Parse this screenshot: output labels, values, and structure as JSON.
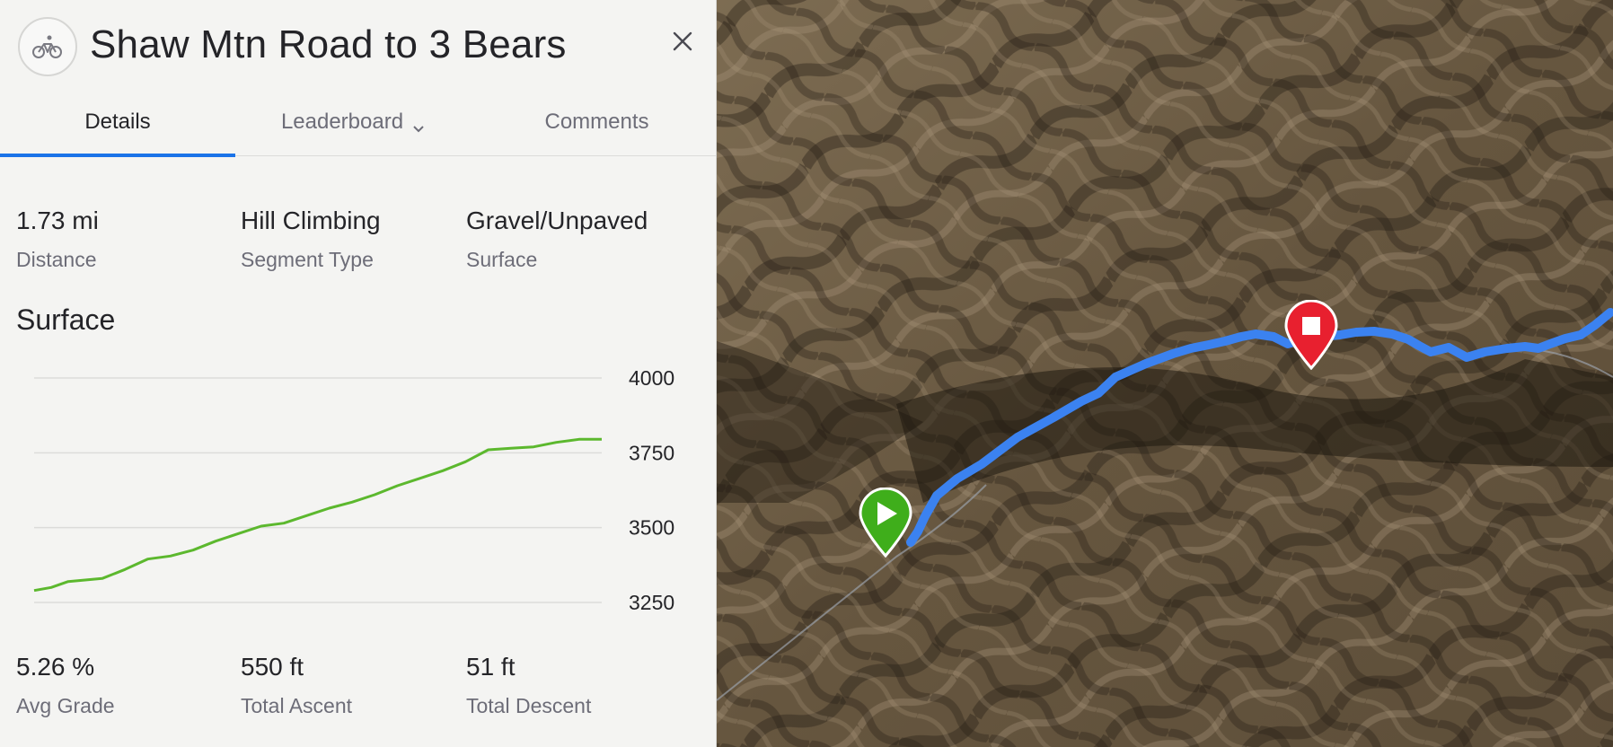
{
  "segment": {
    "title": "Shaw Mtn Road to 3 Bears",
    "sport_icon": "cycling-icon",
    "close_icon": "close-icon"
  },
  "tabs": [
    {
      "label": "Details",
      "active": true
    },
    {
      "label": "Leaderboard",
      "active": false,
      "icon": "chevron-down-icon"
    },
    {
      "label": "Comments",
      "active": false
    }
  ],
  "summary": [
    {
      "value": "1.73 mi",
      "label": "Distance"
    },
    {
      "value": "Hill Climbing",
      "label": "Segment Type"
    },
    {
      "value": "Gravel/Unpaved",
      "label": "Surface"
    }
  ],
  "section_title": "Surface",
  "totals": [
    {
      "value": "5.26 %",
      "label": "Avg Grade"
    },
    {
      "value": "550 ft",
      "label": "Total Ascent"
    },
    {
      "value": "51 ft",
      "label": "Total Descent"
    }
  ],
  "chart_data": {
    "type": "line",
    "title": "",
    "xlabel": "",
    "ylabel": "",
    "ylim": [
      3250,
      4000
    ],
    "y_ticks": [
      4000,
      3750,
      3500,
      3250
    ],
    "grid": true,
    "series": [
      {
        "color": "#5cb82e",
        "x": [
          0,
          0.03,
          0.06,
          0.09,
          0.12,
          0.16,
          0.2,
          0.24,
          0.28,
          0.32,
          0.36,
          0.4,
          0.44,
          0.48,
          0.52,
          0.56,
          0.6,
          0.64,
          0.68,
          0.72,
          0.76,
          0.8,
          0.84,
          0.88,
          0.92,
          0.96,
          1.0
        ],
        "values": [
          3290,
          3300,
          3320,
          3325,
          3330,
          3360,
          3395,
          3405,
          3425,
          3455,
          3480,
          3505,
          3515,
          3540,
          3565,
          3585,
          3610,
          3640,
          3665,
          3690,
          3720,
          3760,
          3765,
          3770,
          3785,
          3795,
          3795
        ]
      }
    ]
  },
  "map": {
    "start_marker": "start-play-icon",
    "end_marker": "finish-stop-icon",
    "route_color": "#3b82f0",
    "start_color": "#3fae1b",
    "end_color": "#e8202f"
  }
}
